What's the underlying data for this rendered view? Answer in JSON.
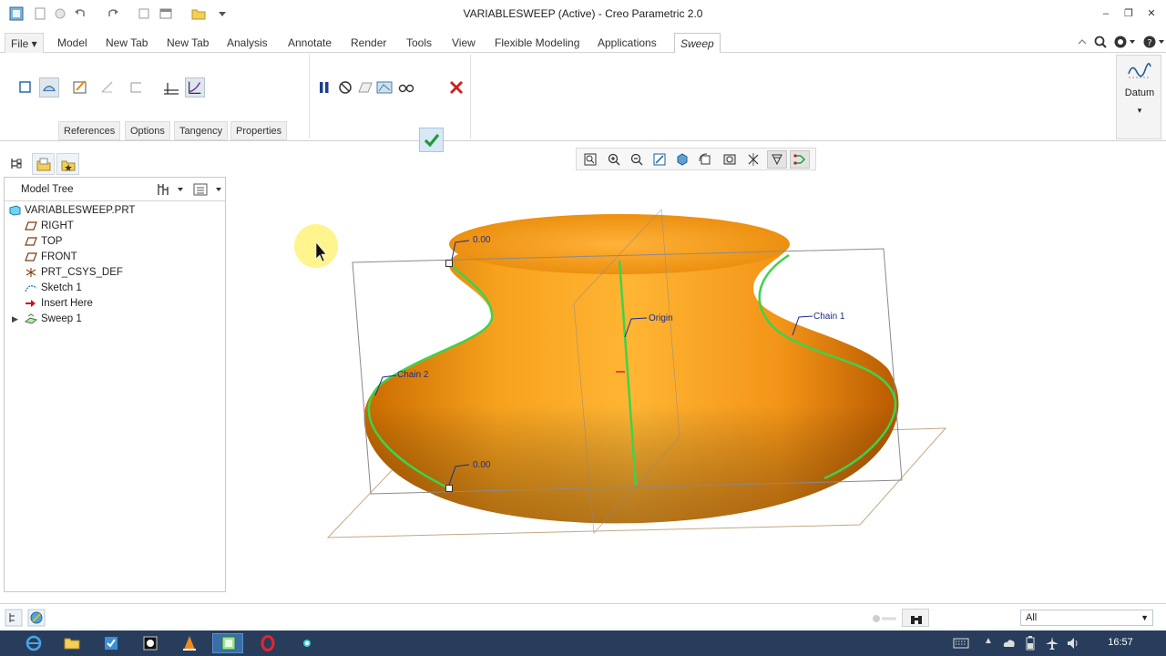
{
  "window": {
    "title": "VARIABLESWEEP (Active) - Creo Parametric 2.0"
  },
  "menu": {
    "tabs": [
      "File",
      "Model",
      "New Tab",
      "New Tab",
      "Analysis",
      "Annotate",
      "Render",
      "Tools",
      "View",
      "Flexible Modeling",
      "Applications",
      "Sweep"
    ],
    "active_tab": "Sweep"
  },
  "ribbon": {
    "sub_tabs": [
      "References",
      "Options",
      "Tangency",
      "Properties"
    ],
    "datum_label": "Datum"
  },
  "model_tree": {
    "header": "Model Tree",
    "root": "VARIABLESWEEP.PRT",
    "items": [
      "RIGHT",
      "TOP",
      "FRONT",
      "PRT_CSYS_DEF",
      "Sketch 1",
      "Insert Here",
      "Sweep 1"
    ]
  },
  "viewport": {
    "labels": {
      "dim_top": "0.00",
      "dim_bottom": "0.00",
      "origin": "Origin",
      "chain1": "Chain 1",
      "chain2": "Chain 2"
    },
    "colors": {
      "body": "#f39a1e",
      "trajectory": "#3fd24a",
      "datum_frame": "#8a8a8a",
      "datum_plane": "#c4a882"
    }
  },
  "status": {
    "filter_value": "All"
  },
  "taskbar": {
    "time": "16:57"
  }
}
